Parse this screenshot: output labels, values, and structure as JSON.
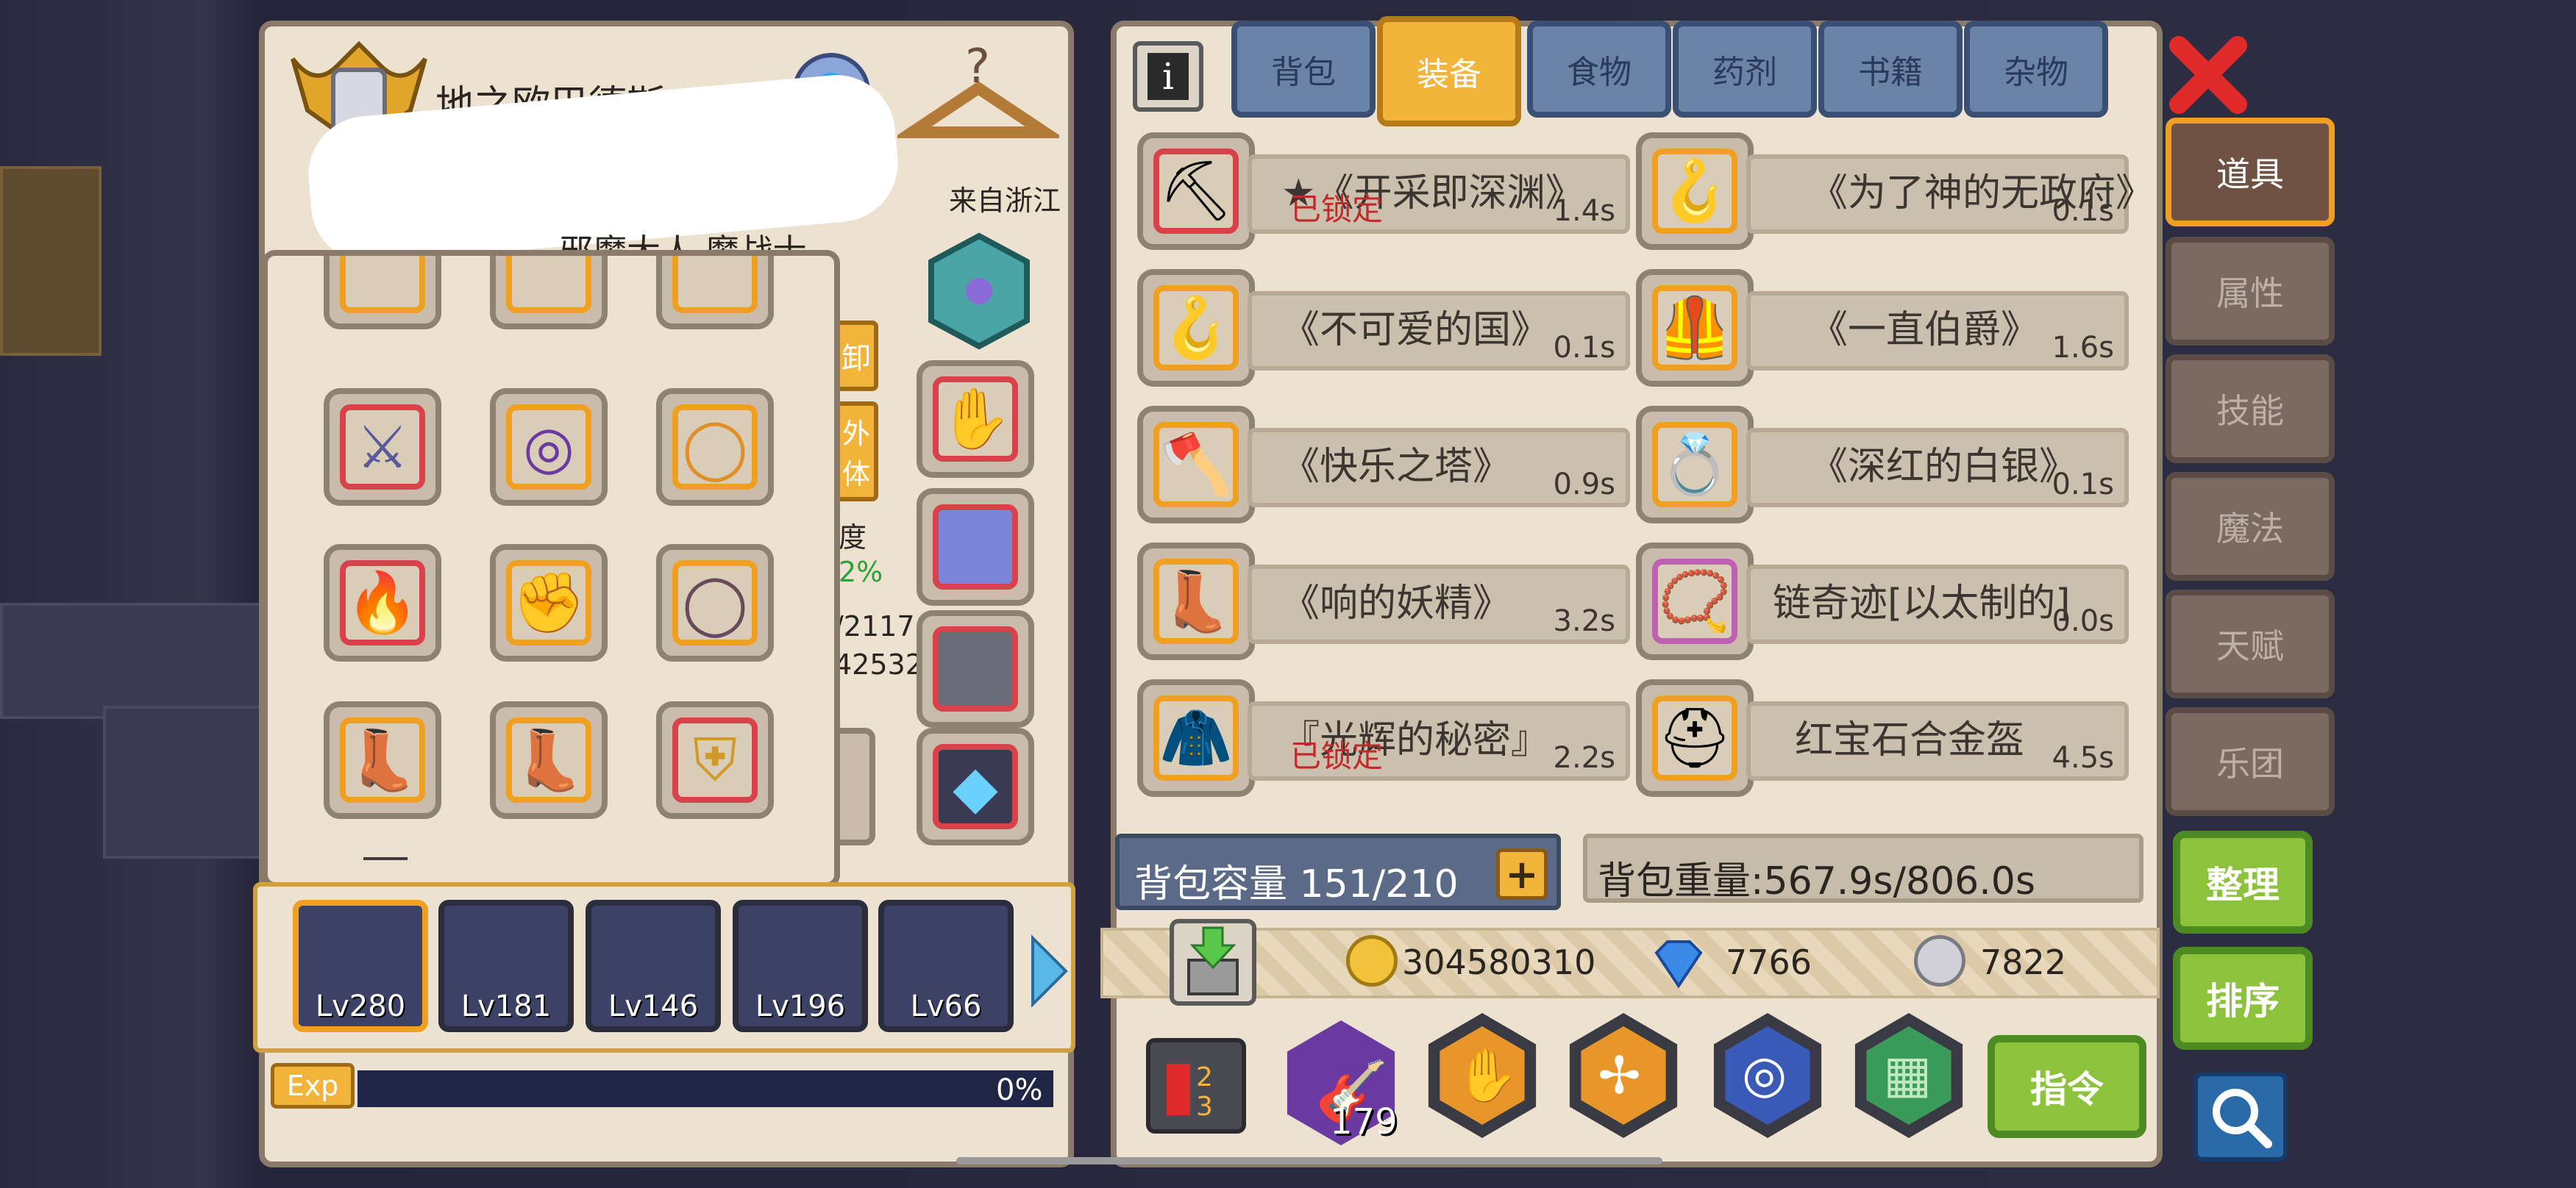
{
  "character": {
    "name": "地之欧巴德斯",
    "origin": "来自浙江",
    "title": "邪魔大人 魔战士"
  },
  "left_buttons": {
    "unequip": "卸",
    "outfit": "外 体"
  },
  "partial_stats": {
    "label": "度",
    "percent": "2%",
    "hp": "/2117",
    "mp": "42532"
  },
  "party": [
    {
      "lv": "Lv280"
    },
    {
      "lv": "Lv181"
    },
    {
      "lv": "Lv146"
    },
    {
      "lv": "Lv196"
    },
    {
      "lv": "Lv66"
    }
  ],
  "exp": {
    "label": "Exp",
    "percent_text": "0%",
    "fraction": 0.0
  },
  "top_tabs": [
    "背包",
    "装备",
    "食物",
    "药剂",
    "书籍",
    "杂物"
  ],
  "active_tab": "装备",
  "side_tabs": [
    "道具",
    "属性",
    "技能",
    "魔法",
    "天赋",
    "乐团"
  ],
  "items": [
    {
      "name": "★《开采即深渊》",
      "time": "1.4s",
      "lock": "已锁定",
      "icon": "pickaxe-icon"
    },
    {
      "name": "《为了神的无政府》",
      "time": "0.1s",
      "lock": "",
      "icon": "claw-icon"
    },
    {
      "name": "《不可爱的国》",
      "time": "0.1s",
      "lock": "",
      "icon": "claw-icon"
    },
    {
      "name": "《一直伯爵》",
      "time": "1.6s",
      "lock": "",
      "icon": "armor-icon"
    },
    {
      "name": "《快乐之塔》",
      "time": "0.9s",
      "lock": "",
      "icon": "axe-icon"
    },
    {
      "name": "《深红的白银》",
      "time": "0.1s",
      "lock": "",
      "icon": "ring-icon"
    },
    {
      "name": "《响的妖精》",
      "time": "3.2s",
      "lock": "",
      "icon": "boots-icon"
    },
    {
      "name": "链奇迹[以太制的]",
      "time": "0.0s",
      "lock": "",
      "icon": "necklace-icon"
    },
    {
      "name": "『光辉的秘密』",
      "time": "2.2s",
      "lock": "已锁定",
      "icon": "robe-icon"
    },
    {
      "name": "红宝石合金盔",
      "time": "4.5s",
      "lock": "",
      "icon": "helmet-icon"
    }
  ],
  "bag": {
    "capacity_label": "背包容量 151/210",
    "weight_label": "背包重量:567.9s/806.0s"
  },
  "currency": {
    "gold": "304580310",
    "gems": "7766",
    "silver": "7822"
  },
  "buttons": {
    "sort": "整理",
    "order": "排序",
    "command": "指令",
    "close": "×"
  },
  "skill_count": "179"
}
